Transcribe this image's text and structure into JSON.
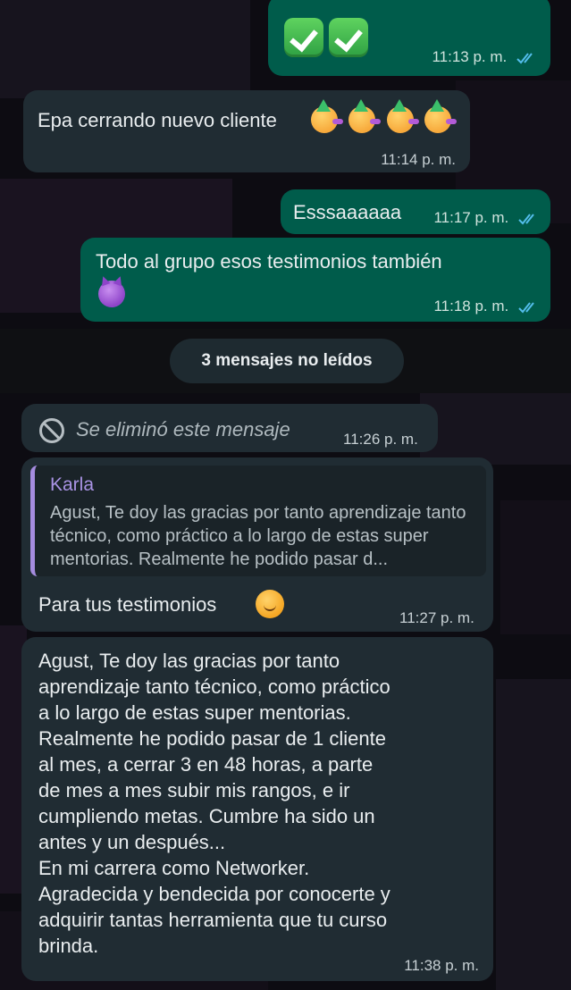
{
  "messages": [
    {
      "id": "m1",
      "direction": "out",
      "content": "✅✅",
      "time": "11:13 p. m."
    },
    {
      "id": "m2",
      "direction": "in",
      "text": "Epa cerrando nuevo cliente",
      "emoji": "🥳🥳🥳🥳",
      "time": "11:14 p. m."
    },
    {
      "id": "m3",
      "direction": "out",
      "text": "Esssaaaaaa",
      "time": "11:17 p. m."
    },
    {
      "id": "m4",
      "direction": "out",
      "text": "Todo al grupo esos testimonios también",
      "emoji": "😈",
      "time": "11:18 p. m."
    },
    {
      "id": "m5",
      "direction": "in",
      "text": "Se eliminó este mensaje",
      "time": "11:26 p. m."
    },
    {
      "id": "m6",
      "direction": "in",
      "quote_author": "Karla",
      "quote_text": "Agust,  Te doy las gracias por tanto aprendizaje tanto técnico, como práctico a lo largo de estas super mentorias. Realmente he podido pasar d...",
      "text": "Para tus testimonios",
      "emoji": "☺️",
      "time": "11:27 p. m."
    },
    {
      "id": "m7",
      "direction": "in",
      "lines": [
        "Agust,  Te doy las gracias por tanto",
        "aprendizaje tanto técnico, como práctico",
        "a lo largo de estas super mentorias.",
        "Realmente he podido pasar de 1 cliente",
        "al mes, a cerrar 3 en 48 horas,  a parte",
        "de mes a mes subir mis rangos, e ir",
        "cumpliendo  metas. Cumbre ha sido un",
        "antes y un después...",
        "En mi carrera como Networker.",
        "Agradecida y bendecida por conocerte y",
        "adquirir tantas herramienta que tu curso",
        "brinda."
      ],
      "time": "11:38 p. m."
    }
  ],
  "unread_divider": "3 mensajes no leídos",
  "colors": {
    "outgoing": "#005c4b",
    "incoming": "#202c33",
    "read_ticks": "#53bdeb",
    "quote_author": "#a993e4"
  },
  "icons": {
    "read_receipt": "double-check-icon",
    "deleted": "blocked-icon"
  }
}
